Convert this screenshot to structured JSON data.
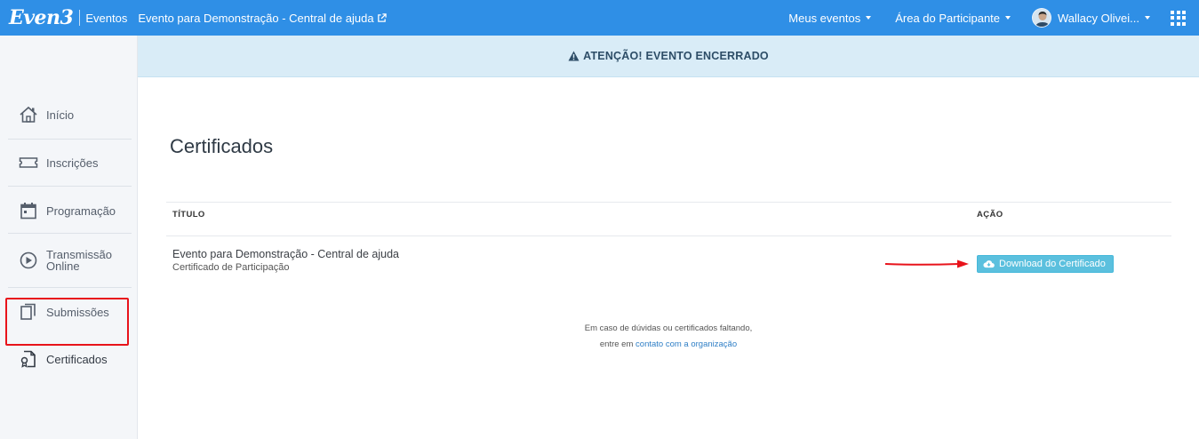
{
  "header": {
    "logo_text": "Even3",
    "events_link": "Eventos",
    "event_title": "Evento para Demonstração - Central de ajuda",
    "menu_my_events": "Meus eventos",
    "menu_participant_area": "Área do Participante",
    "user_name": "Wallacy Olivei..."
  },
  "sidebar": {
    "items": [
      {
        "label": "Início",
        "icon": "home-icon"
      },
      {
        "label": "Inscrições",
        "icon": "ticket-icon"
      },
      {
        "label": "Programação",
        "icon": "calendar-icon"
      },
      {
        "label": "Transmissão",
        "label2": "Online",
        "icon": "play-icon"
      },
      {
        "label": "Submissões",
        "icon": "documents-icon"
      },
      {
        "label": "Certificados",
        "icon": "certificate-icon"
      }
    ],
    "active": "Certificados",
    "highlight_color": "#e8131b"
  },
  "alert": {
    "text": "ATENÇÃO! EVENTO ENCERRADO"
  },
  "main": {
    "title": "Certificados",
    "table": {
      "headers": [
        "TÍTULO",
        "AÇÃO"
      ],
      "rows": [
        {
          "title": "Evento para Demonstração - Central de ajuda",
          "subtitle": "Certificado de Participação",
          "action": "Download do Certificado"
        }
      ]
    },
    "help_line1": "Em caso de dúvidas ou certificados faltando,",
    "help_line2_prefix": "entre em ",
    "help_link": "contato com a organização"
  },
  "colors": {
    "topbar": "#2f8fe6",
    "alert_bg": "#d9ecf7",
    "button": "#5bc0de",
    "annotation_red": "#e8131b"
  }
}
